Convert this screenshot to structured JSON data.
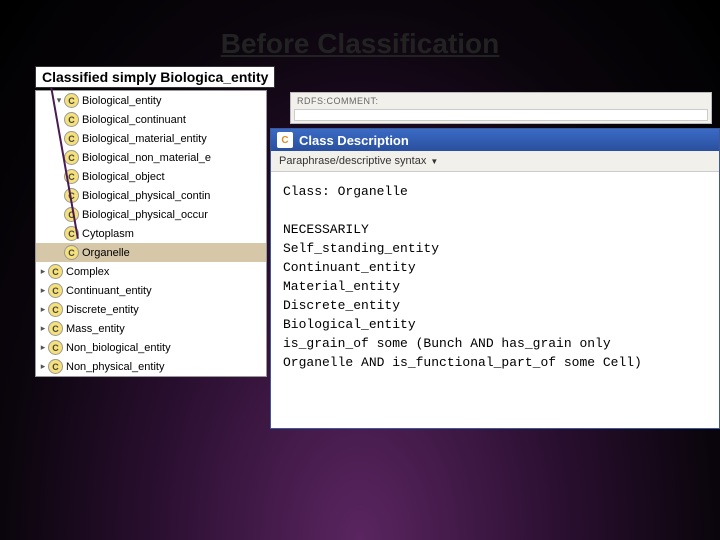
{
  "title": "Before Classification",
  "callout": "Classified simply Biologica_entity",
  "rdfs_header": "RDFS:COMMENT:",
  "tree": {
    "items": [
      {
        "label": "Biological_entity",
        "indent": true,
        "arrow": "▾"
      },
      {
        "label": "Biological_continuant",
        "indent": true,
        "arrow": ""
      },
      {
        "label": "Biological_material_entity",
        "indent": true,
        "arrow": ""
      },
      {
        "label": "Biological_non_material_e",
        "indent": true,
        "arrow": ""
      },
      {
        "label": "Biological_object",
        "indent": true,
        "arrow": ""
      },
      {
        "label": "Biological_physical_contin",
        "indent": true,
        "arrow": ""
      },
      {
        "label": "Biological_physical_occur",
        "indent": true,
        "arrow": ""
      },
      {
        "label": "Cytoplasm",
        "indent": true,
        "arrow": ""
      },
      {
        "label": "Organelle",
        "indent": true,
        "arrow": "",
        "selected": true
      },
      {
        "label": "Complex",
        "indent": false,
        "arrow": "▸"
      },
      {
        "label": "Continuant_entity",
        "indent": false,
        "arrow": "▸"
      },
      {
        "label": "Discrete_entity",
        "indent": false,
        "arrow": "▸"
      },
      {
        "label": "Mass_entity",
        "indent": false,
        "arrow": "▸"
      },
      {
        "label": "Non_biological_entity",
        "indent": false,
        "arrow": "▸"
      },
      {
        "label": "Non_physical_entity",
        "indent": false,
        "arrow": "▸"
      }
    ]
  },
  "description": {
    "window_title": "Class Description",
    "syntax_label": "Paraphrase/descriptive syntax",
    "lines": [
      "Class: Organelle",
      "",
      "NECESSARILY",
      "Self_standing_entity",
      "Continuant_entity",
      "Material_entity",
      "Discrete_entity",
      "Biological_entity",
      "is_grain_of some (Bunch AND has_grain only",
      "Organelle AND is_functional_part_of some Cell)"
    ]
  }
}
